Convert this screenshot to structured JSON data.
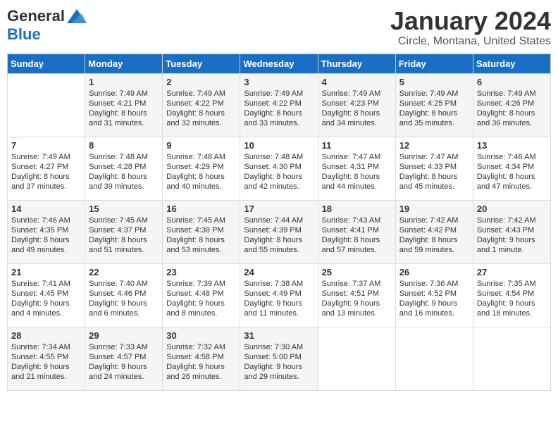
{
  "logo": {
    "general": "General",
    "blue": "Blue"
  },
  "title": "January 2024",
  "subtitle": "Circle, Montana, United States",
  "days_header": [
    "Sunday",
    "Monday",
    "Tuesday",
    "Wednesday",
    "Thursday",
    "Friday",
    "Saturday"
  ],
  "weeks": [
    [
      {
        "day": "",
        "content": ""
      },
      {
        "day": "1",
        "content": "Sunrise: 7:49 AM\nSunset: 4:21 PM\nDaylight: 8 hours\nand 31 minutes."
      },
      {
        "day": "2",
        "content": "Sunrise: 7:49 AM\nSunset: 4:22 PM\nDaylight: 8 hours\nand 32 minutes."
      },
      {
        "day": "3",
        "content": "Sunrise: 7:49 AM\nSunset: 4:22 PM\nDaylight: 8 hours\nand 33 minutes."
      },
      {
        "day": "4",
        "content": "Sunrise: 7:49 AM\nSunset: 4:23 PM\nDaylight: 8 hours\nand 34 minutes."
      },
      {
        "day": "5",
        "content": "Sunrise: 7:49 AM\nSunset: 4:25 PM\nDaylight: 8 hours\nand 35 minutes."
      },
      {
        "day": "6",
        "content": "Sunrise: 7:49 AM\nSunset: 4:26 PM\nDaylight: 8 hours\nand 36 minutes."
      }
    ],
    [
      {
        "day": "7",
        "content": "Sunrise: 7:49 AM\nSunset: 4:27 PM\nDaylight: 8 hours\nand 37 minutes."
      },
      {
        "day": "8",
        "content": "Sunrise: 7:48 AM\nSunset: 4:28 PM\nDaylight: 8 hours\nand 39 minutes."
      },
      {
        "day": "9",
        "content": "Sunrise: 7:48 AM\nSunset: 4:29 PM\nDaylight: 8 hours\nand 40 minutes."
      },
      {
        "day": "10",
        "content": "Sunrise: 7:48 AM\nSunset: 4:30 PM\nDaylight: 8 hours\nand 42 minutes."
      },
      {
        "day": "11",
        "content": "Sunrise: 7:47 AM\nSunset: 4:31 PM\nDaylight: 8 hours\nand 44 minutes."
      },
      {
        "day": "12",
        "content": "Sunrise: 7:47 AM\nSunset: 4:33 PM\nDaylight: 8 hours\nand 45 minutes."
      },
      {
        "day": "13",
        "content": "Sunrise: 7:46 AM\nSunset: 4:34 PM\nDaylight: 8 hours\nand 47 minutes."
      }
    ],
    [
      {
        "day": "14",
        "content": "Sunrise: 7:46 AM\nSunset: 4:35 PM\nDaylight: 8 hours\nand 49 minutes."
      },
      {
        "day": "15",
        "content": "Sunrise: 7:45 AM\nSunset: 4:37 PM\nDaylight: 8 hours\nand 51 minutes."
      },
      {
        "day": "16",
        "content": "Sunrise: 7:45 AM\nSunset: 4:38 PM\nDaylight: 8 hours\nand 53 minutes."
      },
      {
        "day": "17",
        "content": "Sunrise: 7:44 AM\nSunset: 4:39 PM\nDaylight: 8 hours\nand 55 minutes."
      },
      {
        "day": "18",
        "content": "Sunrise: 7:43 AM\nSunset: 4:41 PM\nDaylight: 8 hours\nand 57 minutes."
      },
      {
        "day": "19",
        "content": "Sunrise: 7:42 AM\nSunset: 4:42 PM\nDaylight: 8 hours\nand 59 minutes."
      },
      {
        "day": "20",
        "content": "Sunrise: 7:42 AM\nSunset: 4:43 PM\nDaylight: 9 hours\nand 1 minute."
      }
    ],
    [
      {
        "day": "21",
        "content": "Sunrise: 7:41 AM\nSunset: 4:45 PM\nDaylight: 9 hours\nand 4 minutes."
      },
      {
        "day": "22",
        "content": "Sunrise: 7:40 AM\nSunset: 4:46 PM\nDaylight: 9 hours\nand 6 minutes."
      },
      {
        "day": "23",
        "content": "Sunrise: 7:39 AM\nSunset: 4:48 PM\nDaylight: 9 hours\nand 8 minutes."
      },
      {
        "day": "24",
        "content": "Sunrise: 7:38 AM\nSunset: 4:49 PM\nDaylight: 9 hours\nand 11 minutes."
      },
      {
        "day": "25",
        "content": "Sunrise: 7:37 AM\nSunset: 4:51 PM\nDaylight: 9 hours\nand 13 minutes."
      },
      {
        "day": "26",
        "content": "Sunrise: 7:36 AM\nSunset: 4:52 PM\nDaylight: 9 hours\nand 16 minutes."
      },
      {
        "day": "27",
        "content": "Sunrise: 7:35 AM\nSunset: 4:54 PM\nDaylight: 9 hours\nand 18 minutes."
      }
    ],
    [
      {
        "day": "28",
        "content": "Sunrise: 7:34 AM\nSunset: 4:55 PM\nDaylight: 9 hours\nand 21 minutes."
      },
      {
        "day": "29",
        "content": "Sunrise: 7:33 AM\nSunset: 4:57 PM\nDaylight: 9 hours\nand 24 minutes."
      },
      {
        "day": "30",
        "content": "Sunrise: 7:32 AM\nSunset: 4:58 PM\nDaylight: 9 hours\nand 26 minutes."
      },
      {
        "day": "31",
        "content": "Sunrise: 7:30 AM\nSunset: 5:00 PM\nDaylight: 9 hours\nand 29 minutes."
      },
      {
        "day": "",
        "content": ""
      },
      {
        "day": "",
        "content": ""
      },
      {
        "day": "",
        "content": ""
      }
    ]
  ]
}
